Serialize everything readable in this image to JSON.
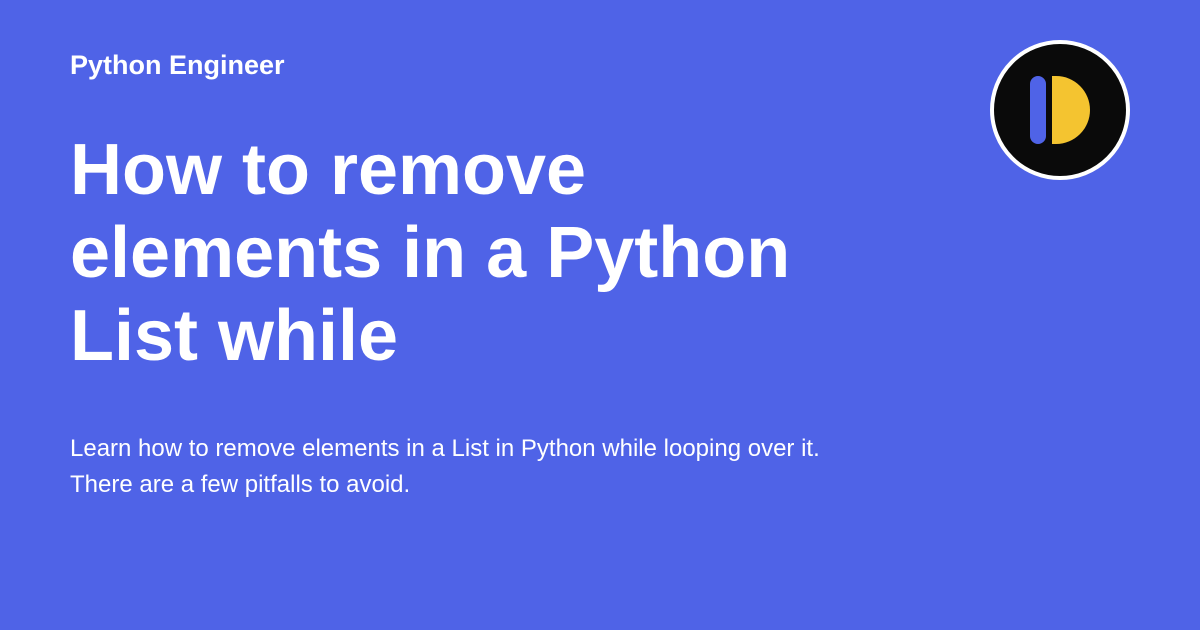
{
  "site_name": "Python Engineer",
  "title": "How to remove elements in a Python List while",
  "description": "Learn how to remove elements in a List in Python while looping over it. There are a few pitfalls to avoid.",
  "colors": {
    "background": "#4F63E7",
    "text": "#ffffff",
    "logo_bg": "#0a0a0a",
    "logo_bar": "#4F63E7",
    "logo_d": "#F4C430"
  }
}
